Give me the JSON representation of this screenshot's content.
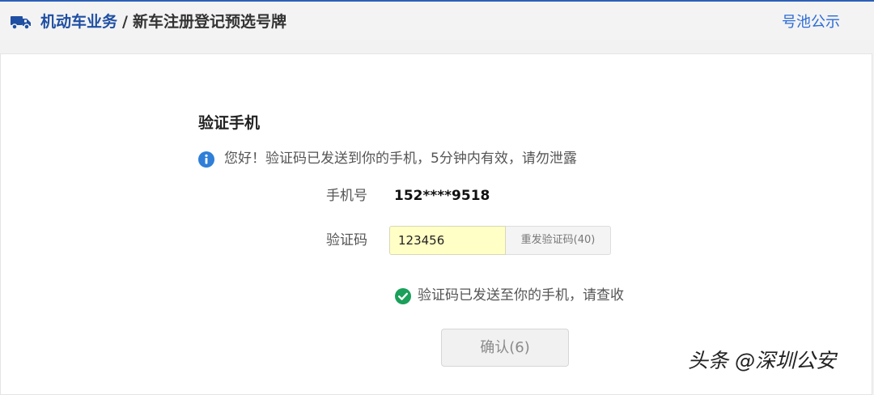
{
  "header": {
    "icon": "truck-icon",
    "breadcrumb_root": "机动车业务",
    "breadcrumb_separator": "/",
    "breadcrumb_current": "新车注册登记预选号牌",
    "pool_link": "号池公示"
  },
  "verify": {
    "title": "验证手机",
    "info_icon": "info-icon",
    "info_text": "您好！验证码已发送到你的手机，5分钟内有效，请勿泄露",
    "phone_label": "手机号",
    "phone_value": "152****9518",
    "code_label": "验证码",
    "code_value": "123456",
    "resend_label": "重发验证码(40)",
    "success_icon": "check-circle-icon",
    "success_text": "验证码已发送至你的手机，请查收",
    "confirm_label": "确认(6)"
  },
  "watermark": {
    "text": "头条 @深圳公安"
  },
  "colors": {
    "accent": "#2b5fb8",
    "link": "#2b6bd6",
    "info": "#2f7fd8",
    "success": "#1aa05a",
    "input_highlight": "#ffffc6"
  }
}
